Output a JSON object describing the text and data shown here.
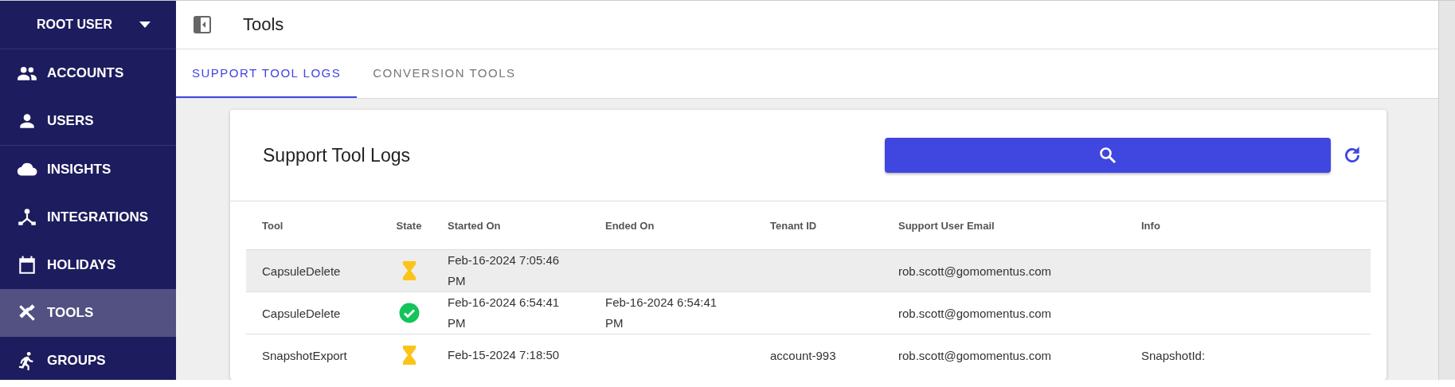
{
  "sidebar": {
    "user": "ROOT USER",
    "sections": [
      [
        {
          "label": "ACCOUNTS",
          "selected": false
        },
        {
          "label": "USERS",
          "selected": false
        }
      ],
      [
        {
          "label": "INSIGHTS",
          "selected": false
        },
        {
          "label": "INTEGRATIONS",
          "selected": false
        },
        {
          "label": "HOLIDAYS",
          "selected": false
        },
        {
          "label": "TOOLS",
          "selected": true
        },
        {
          "label": "GROUPS",
          "selected": false
        }
      ]
    ]
  },
  "header": {
    "title": "Tools"
  },
  "tabs": [
    {
      "label": "SUPPORT TOOL LOGS",
      "selected": true
    },
    {
      "label": "CONVERSION TOOLS",
      "selected": false
    }
  ],
  "card": {
    "title": "Support Tool Logs"
  },
  "table": {
    "columns": [
      "Tool",
      "State",
      "Started On",
      "Ended On",
      "Tenant ID",
      "Support User Email",
      "Info"
    ],
    "rows": [
      {
        "tool": "CapsuleDelete",
        "done": false,
        "started": [
          "Feb-16-2024 7:05:46",
          "PM"
        ],
        "ended": [],
        "tenant": "",
        "email": "rob.scott@gomomentus.com",
        "info": "",
        "selected": true
      },
      {
        "tool": "CapsuleDelete",
        "done": true,
        "started": [
          "Feb-16-2024 6:54:41",
          "PM"
        ],
        "ended": [
          "Feb-16-2024 6:54:41",
          "PM"
        ],
        "tenant": "",
        "email": "rob.scott@gomomentus.com",
        "info": "",
        "selected": false
      },
      {
        "tool": "SnapshotExport",
        "done": false,
        "started": [
          "Feb-15-2024 7:18:50"
        ],
        "ended": [],
        "tenant": "account-993",
        "email": "rob.scott@gomomentus.com",
        "info": "SnapshotId:",
        "selected": false
      }
    ]
  }
}
